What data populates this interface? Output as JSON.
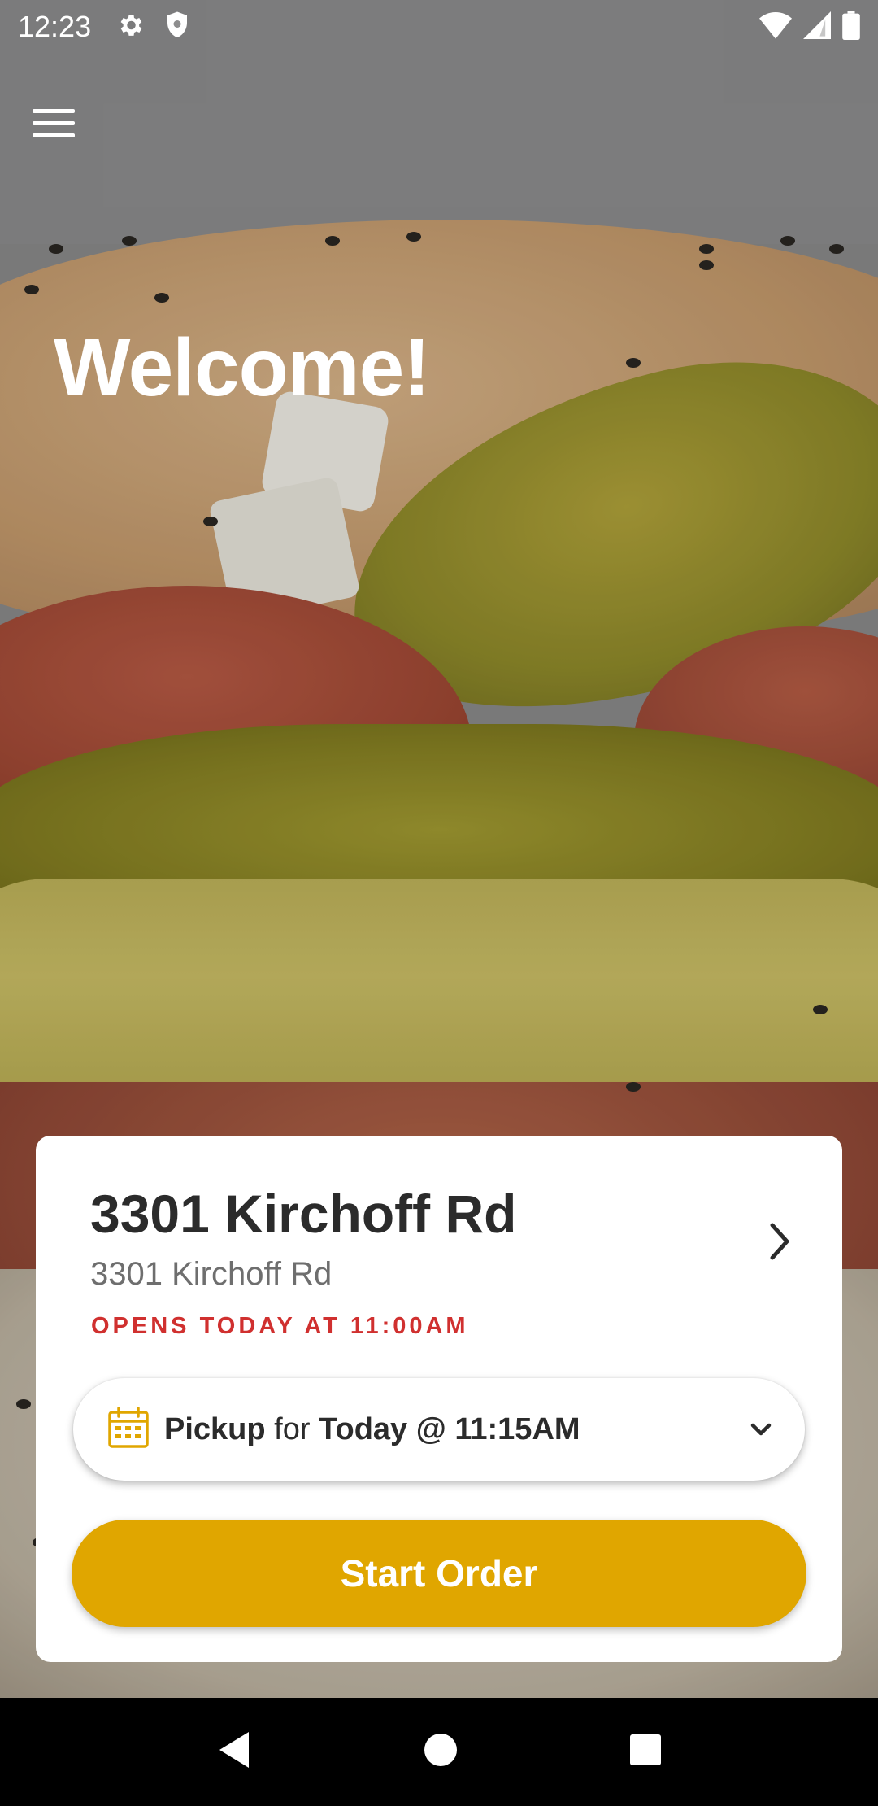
{
  "status_bar": {
    "time": "12:23",
    "left_icons": [
      "gear-icon",
      "shield-icon"
    ],
    "right_icons": [
      "wifi-icon",
      "cell-signal-icon",
      "battery-icon"
    ]
  },
  "header": {
    "menu_icon": "hamburger-menu-icon",
    "welcome_text": "Welcome!"
  },
  "store_card": {
    "name": "3301 Kirchoff Rd",
    "address": "3301 Kirchoff Rd",
    "hours_status": "OPENS TODAY AT 11:00AM",
    "pickup": {
      "mode": "Pickup",
      "connector": "for",
      "time": "Today @ 11:15AM"
    },
    "start_order_label": "Start Order"
  },
  "colors": {
    "accent": "#e0a600",
    "hours_red": "#d0302f",
    "calendar_icon": "#e0a600"
  },
  "nav_bar": {
    "icons": [
      "back-icon",
      "home-icon",
      "recents-icon"
    ]
  }
}
